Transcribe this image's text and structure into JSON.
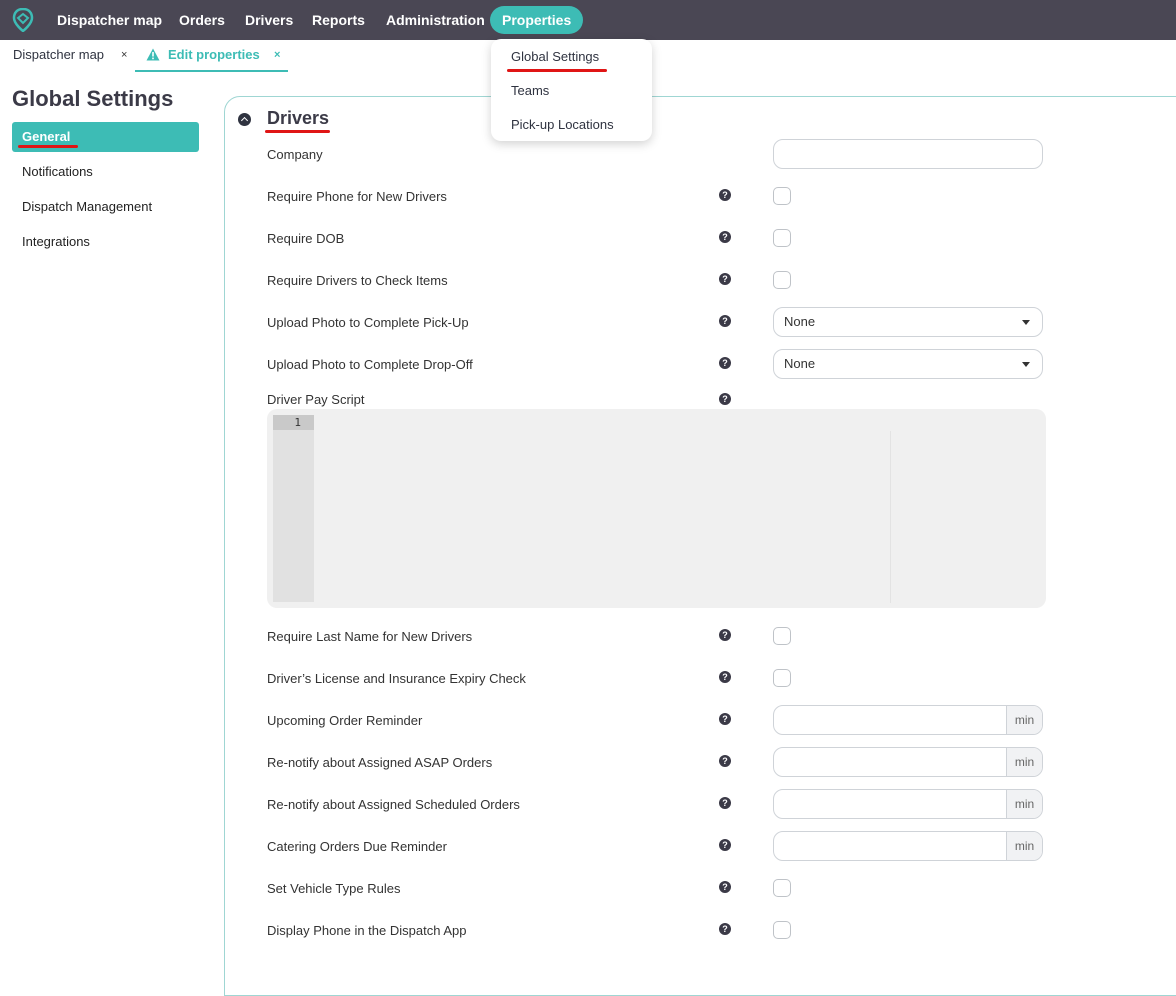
{
  "nav": {
    "items": [
      "Dispatcher map",
      "Orders",
      "Drivers",
      "Reports",
      "Administration",
      "Properties"
    ],
    "active": "Properties",
    "accent_color": "#3dbcb5",
    "bar_color": "#4a4754"
  },
  "tabs": {
    "items": [
      {
        "label": "Dispatcher map",
        "close": "×"
      },
      {
        "label": "Edit properties",
        "close": "×",
        "icon": "warning-icon"
      }
    ]
  },
  "dropdown": {
    "items": [
      "Global Settings",
      "Teams",
      "Pick-up Locations"
    ]
  },
  "sidebar": {
    "title": "Global Settings",
    "items": [
      "General",
      "Notifications",
      "Dispatch Management",
      "Integrations"
    ],
    "active": "General"
  },
  "section": {
    "title": "Drivers",
    "help_glyph": "?",
    "rows": {
      "company": "Company",
      "require_phone": "Require Phone for New Drivers",
      "require_dob": "Require DOB",
      "require_check_items": "Require Drivers to Check Items",
      "photo_pickup": "Upload Photo to Complete Pick-Up",
      "photo_pickup_value": "None",
      "photo_dropoff": "Upload Photo to Complete Drop-Off",
      "photo_dropoff_value": "None",
      "pay_script": "Driver Pay Script",
      "editor_line": "1",
      "require_last_name": "Require Last Name for New Drivers",
      "license_check": "Driver’s License and Insurance Expiry Check",
      "upcoming_reminder": "Upcoming Order Reminder",
      "renotify_asap": "Re-notify about Assigned ASAP Orders",
      "renotify_scheduled": "Re-notify about Assigned Scheduled Orders",
      "catering_reminder": "Catering Orders Due Reminder",
      "vehicle_rules": "Set Vehicle Type Rules",
      "display_phone": "Display Phone in the Dispatch App",
      "unit": "min"
    }
  }
}
